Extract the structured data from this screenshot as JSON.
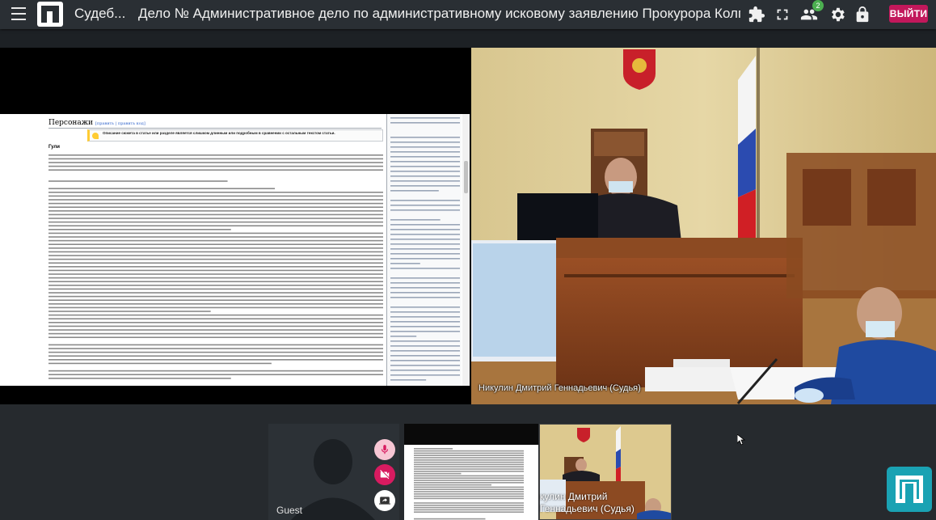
{
  "header": {
    "app_title": "Судеб...",
    "case_title": "Дело № Административное дело по административному исковому заявлению Прокурора Колпинског...",
    "participants_count": "2",
    "exit_label": "ВЫЙТИ"
  },
  "icons": {
    "menu": "hamburger-icon",
    "logo": "app-logo",
    "plugins": "puzzle-icon",
    "fullscreen": "fullscreen-icon",
    "participants": "people-icon",
    "settings": "gear-icon",
    "lock": "lock-icon",
    "mic": "mic-icon",
    "camera": "camera-off-icon",
    "share": "screen-share-icon"
  },
  "shared_document": {
    "section_heading": "Персонажи",
    "edit_links": "[править | править код]",
    "notice": "Описание сюжета в статье или разделе является слишком длинным или подробным в сравнении с остальным текстом статьи.",
    "subheading": "Гули"
  },
  "main_video": {
    "speaker": "Никулин Дмитрий Геннадьевич (Судья)"
  },
  "participants": [
    {
      "name": "Guest"
    },
    {
      "name": "Никулин Дмитрий Геннадьевич (Судья)",
      "short_line1": "кулин Дмитрий",
      "short_line2": "Геннадьевич (Судья)"
    }
  ],
  "colors": {
    "topbar": "#2a2f34",
    "exit": "#c2185b",
    "badge": "#4caf50",
    "corner_logo": "#1aa2b3",
    "mic_btn": "#f7c6d4",
    "cam_btn": "#d81b60"
  }
}
